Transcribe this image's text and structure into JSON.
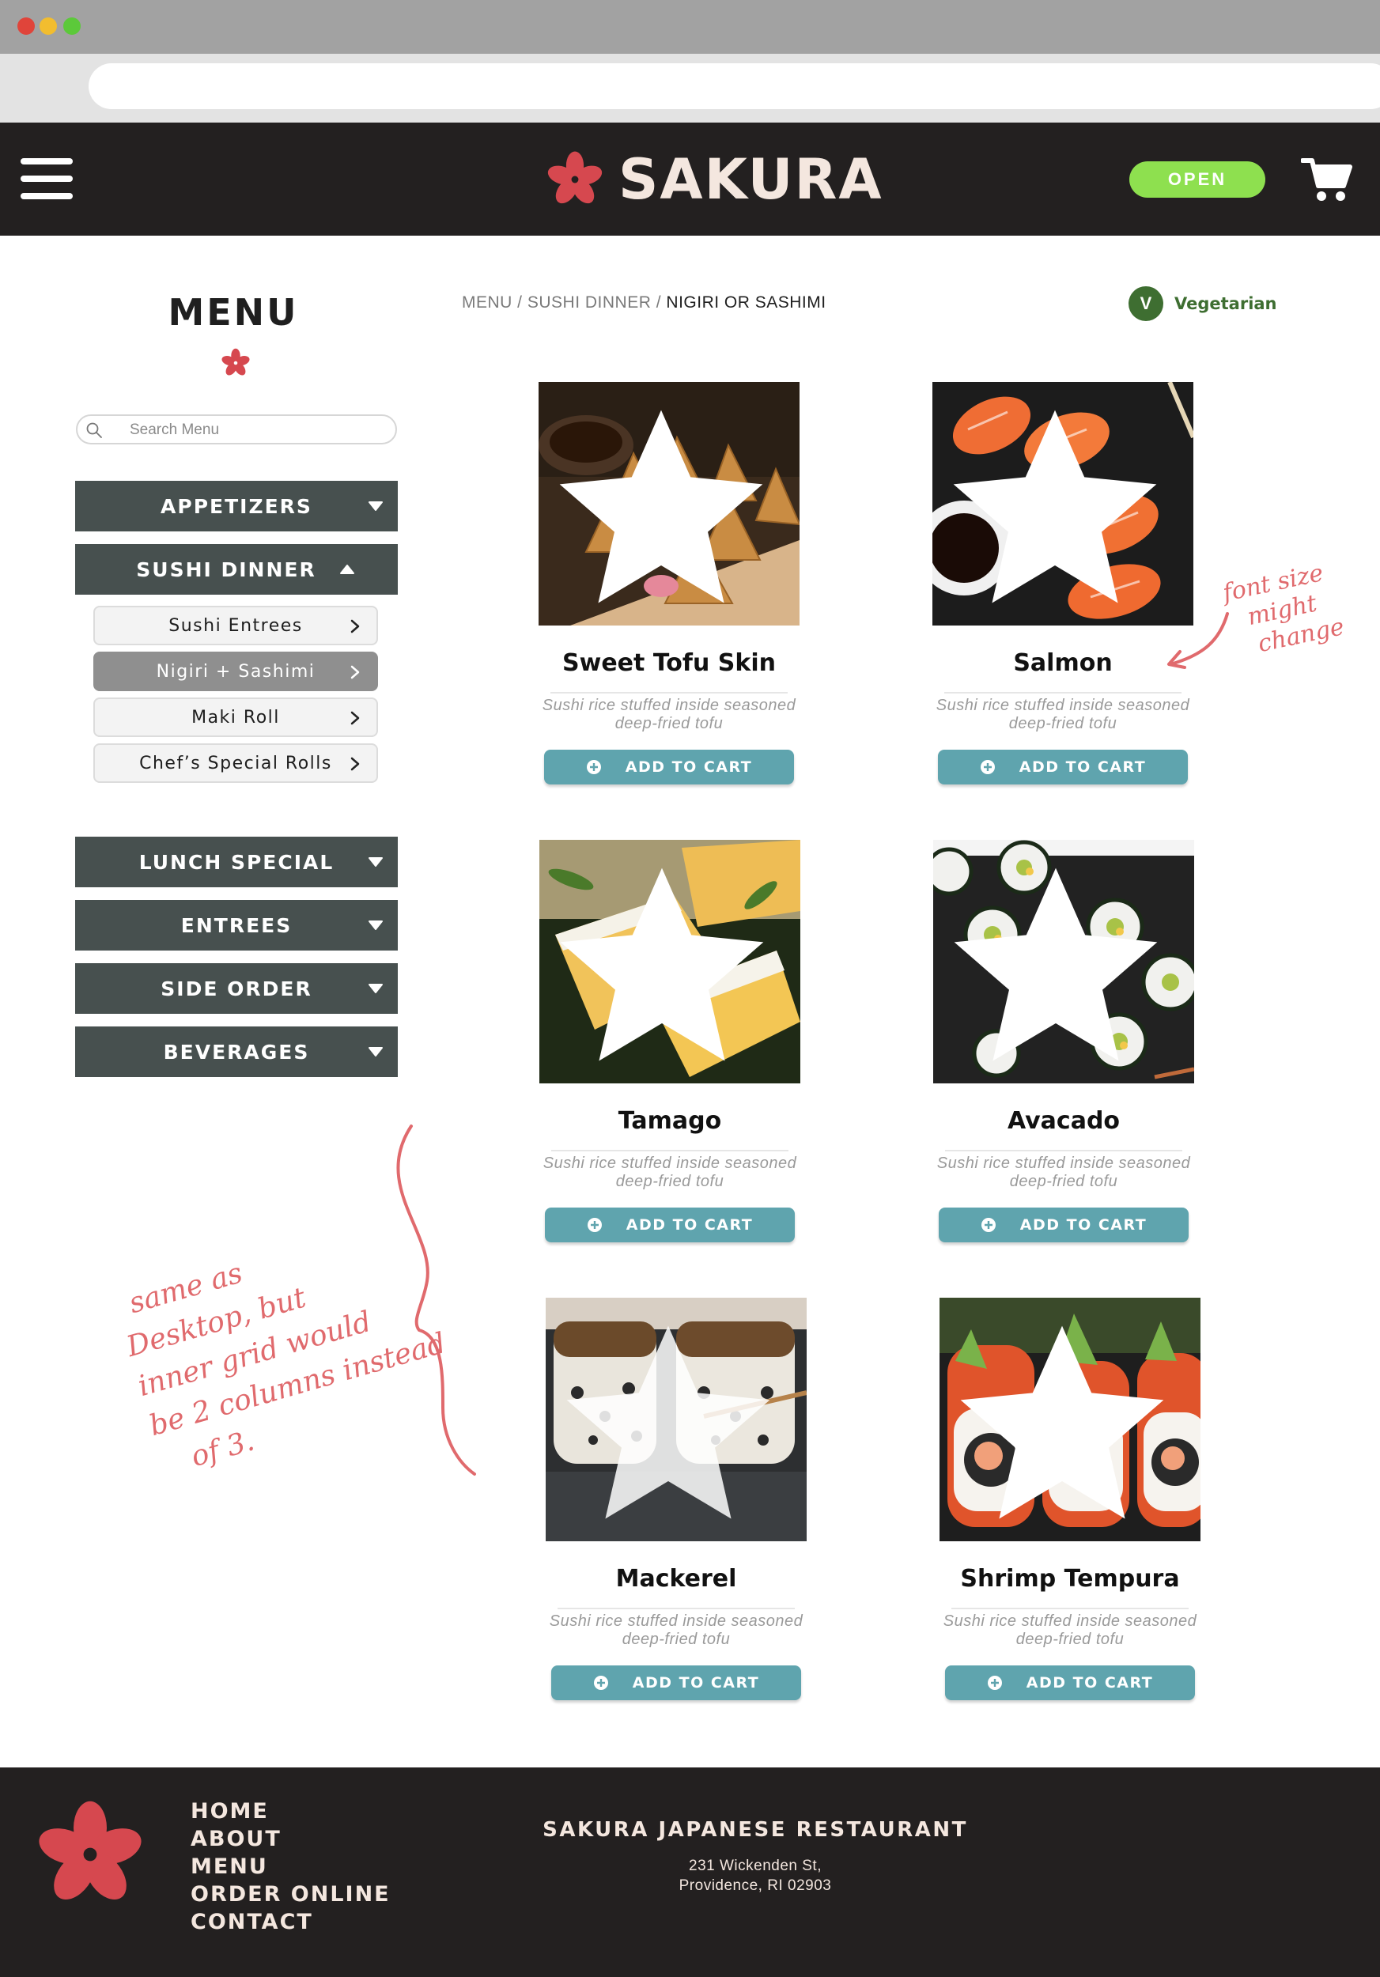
{
  "app": {
    "brand": "SAKURA",
    "status": "OPEN"
  },
  "colors": {
    "header_bg": "#232020",
    "brand_red": "#d6484f",
    "category_bg": "#47504f",
    "add_button": "#5fa4ae",
    "open_badge": "#8ee04f",
    "vegetarian": "#3e6e31"
  },
  "sidebar": {
    "title": "MENU",
    "search_placeholder": "Search Menu",
    "categories": [
      {
        "label": "APPETIZERS",
        "expanded": false
      },
      {
        "label": "SUSHI DINNER",
        "expanded": true
      },
      {
        "label": "LUNCH SPECIAL",
        "expanded": false
      },
      {
        "label": "ENTREES",
        "expanded": false
      },
      {
        "label": "SIDE ORDER",
        "expanded": false
      },
      {
        "label": "BEVERAGES",
        "expanded": false
      }
    ],
    "subitems": [
      {
        "label": "Sushi Entrees",
        "active": false
      },
      {
        "label": "Nigiri + Sashimi",
        "active": true
      },
      {
        "label": "Maki Roll",
        "active": false
      },
      {
        "label": "Chef’s Special Rolls",
        "active": false
      }
    ]
  },
  "breadcrumb": {
    "part1": "MENU",
    "sep": " / ",
    "part2": "SUSHI DINNER",
    "current": "NIGIRI OR SASHIMI"
  },
  "filter": {
    "badge": "V",
    "label": "Vegetarian"
  },
  "products": [
    {
      "name": "Sweet Tofu Skin",
      "desc": "Sushi rice stuffed inside seasoned deep-fried tofu",
      "button": "ADD TO CART",
      "icon": "star-icon"
    },
    {
      "name": "Salmon",
      "desc": "Sushi rice stuffed inside seasoned deep-fried tofu",
      "button": "ADD TO CART",
      "icon": "star-icon"
    },
    {
      "name": "Tamago",
      "desc": "Sushi rice stuffed inside seasoned deep-fried tofu",
      "button": "ADD TO CART",
      "icon": "star-icon"
    },
    {
      "name": "Avacado",
      "desc": "Sushi rice stuffed inside seasoned deep-fried tofu",
      "button": "ADD TO CART",
      "icon": "star-icon"
    },
    {
      "name": "Mackerel",
      "desc": "Sushi rice stuffed inside seasoned deep-fried tofu",
      "button": "ADD TO CART",
      "icon": "star-icon"
    },
    {
      "name": "Shrimp Tempura",
      "desc": "Sushi rice stuffed inside seasoned deep-fried tofu",
      "button": "ADD TO CART",
      "icon": "star-icon"
    }
  ],
  "annotations": {
    "font_note_1": "font size",
    "font_note_2": "might",
    "font_note_3": "change",
    "grid_note_1": "same as",
    "grid_note_2": "Desktop, but",
    "grid_note_3": "inner grid would",
    "grid_note_4": "be 2 columns instead",
    "grid_note_5": "of 3."
  },
  "footer": {
    "links": [
      "HOME",
      "ABOUT",
      "MENU",
      "ORDER ONLINE",
      "CONTACT"
    ],
    "name": "SAKURA JAPANESE RESTAURANT",
    "address_line1": "231 Wickenden St,",
    "address_line2": "Providence, RI 02903"
  }
}
